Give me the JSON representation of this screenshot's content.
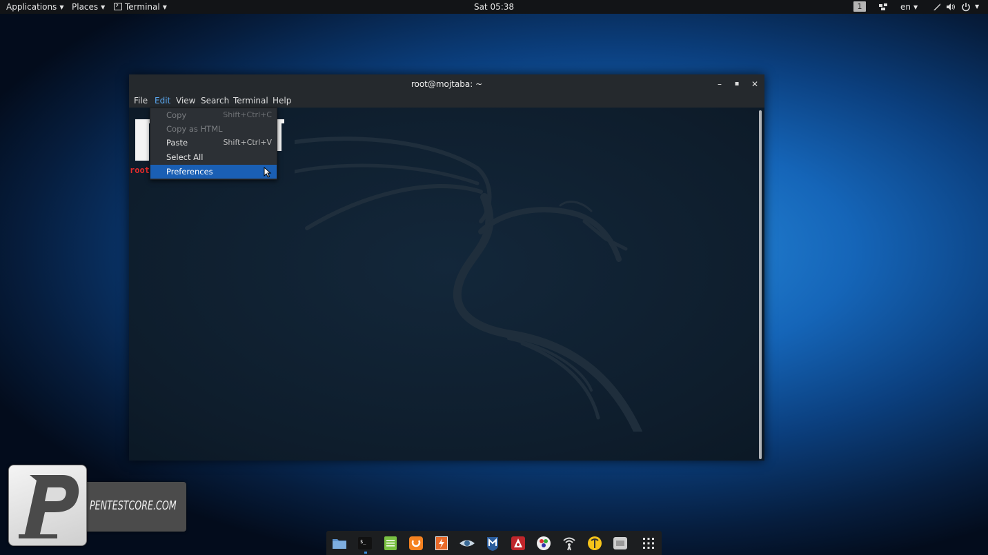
{
  "topbar": {
    "applications": "Applications",
    "places": "Places",
    "app_menu": "Terminal",
    "clock": "Sat 05:38",
    "workspace": "1",
    "language": "en"
  },
  "window": {
    "title": "root@mojtaba: ~",
    "menu": [
      "File",
      "Edit",
      "View",
      "Search",
      "Terminal",
      "Help"
    ],
    "prompt": "root"
  },
  "edit_menu": {
    "items": [
      {
        "label": "Copy",
        "accel": "Shift+Ctrl+C",
        "enabled": false
      },
      {
        "label": "Copy as HTML",
        "accel": "",
        "enabled": false
      },
      {
        "label": "Paste",
        "accel": "Shift+Ctrl+V",
        "enabled": true
      },
      {
        "label": "Select All",
        "accel": "",
        "enabled": true
      },
      {
        "label": "Preferences",
        "accel": "",
        "enabled": true,
        "highlighted": true
      }
    ]
  },
  "watermark": {
    "letter": "P",
    "text": "PENTESTCORE.COM"
  },
  "dock": {
    "icons": [
      "files-icon",
      "terminal-icon",
      "text-editor-icon",
      "burp-suite-icon",
      "zap-icon",
      "eye-icon",
      "metasploit-icon",
      "armitage-icon",
      "color-picker-icon",
      "wifi-tool-icon",
      "maltego-icon",
      "screenshot-icon",
      "app-grid-icon"
    ]
  },
  "colors": {
    "accent": "#1a5fb4",
    "prompt_red": "#e52b2b",
    "panel": "#121417"
  }
}
